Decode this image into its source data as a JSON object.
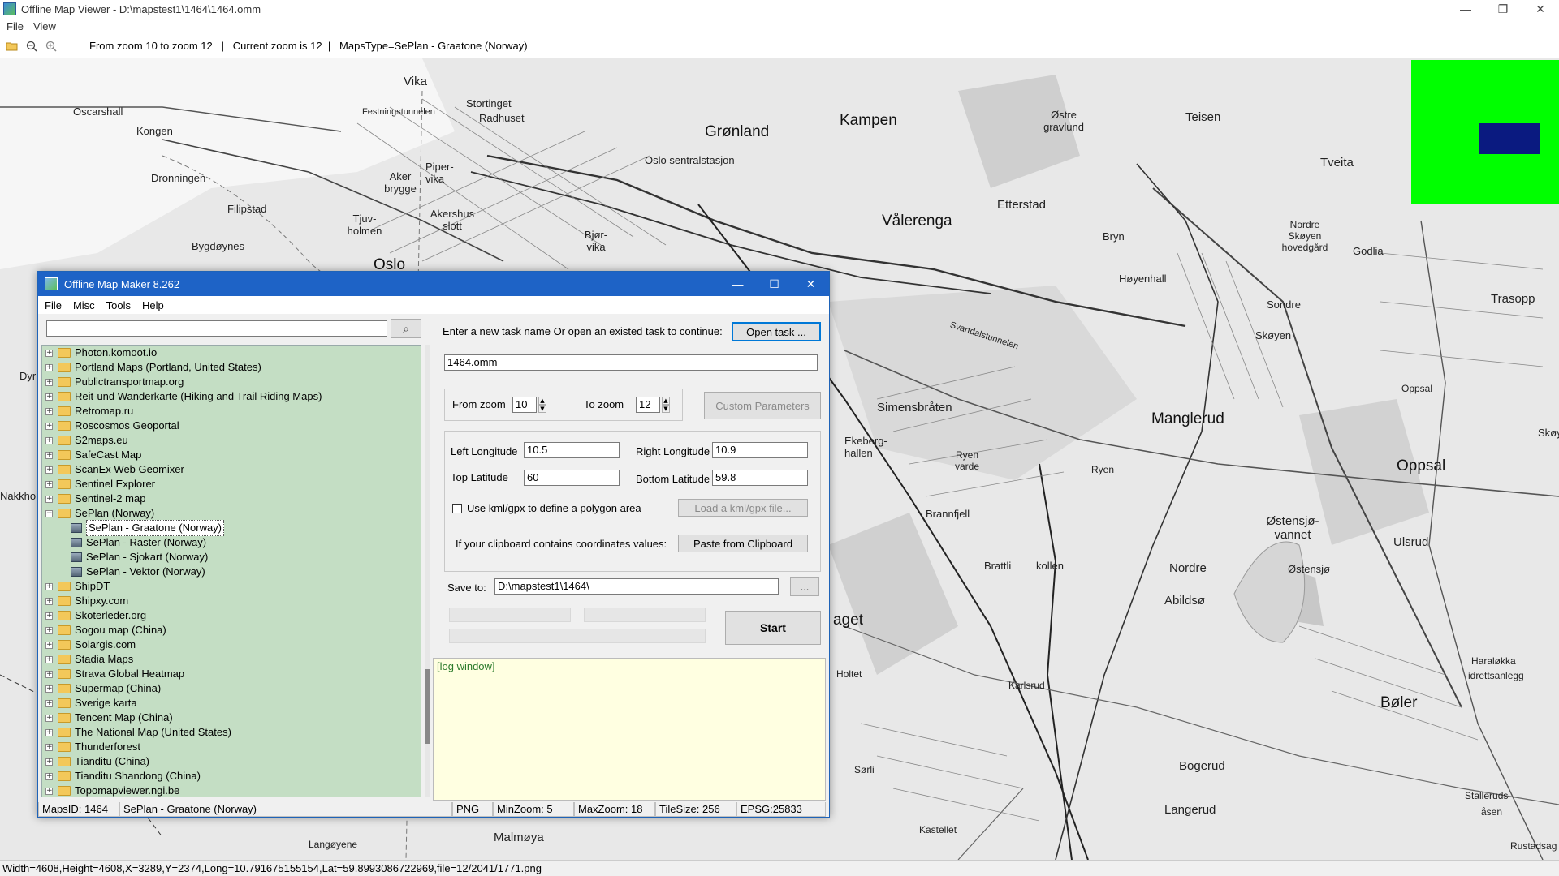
{
  "outer_window": {
    "title": "Offline Map Viewer - D:\\mapstest1\\1464\\1464.omm",
    "menu": [
      "File",
      "View"
    ],
    "toolbar_status": "From zoom 10 to zoom 12   |   Current zoom is 12  |   MapsType=SePlan - Graatone (Norway)",
    "controls": {
      "minimize": "—",
      "maximize": "❐",
      "close": "✕"
    }
  },
  "map": {
    "labels": [
      "Vika",
      "Stortinget",
      "Radhuset",
      "Festningstunnelen",
      "Oscarshall",
      "Kongen",
      "Dronningen",
      "Filipstad",
      "Bygdøynes",
      "Oslo",
      "Aker brygge",
      "Piper-vika",
      "Tjuv-holmen",
      "Akershus slott",
      "Bjør-vika",
      "Grønland",
      "Oslo sentralstasjon",
      "Kampen",
      "Østre gravlund",
      "Teisen",
      "Tveita",
      "Vålerenga",
      "Etterstad",
      "Bryn",
      "Nordre Skøyen hovedgård",
      "Godlia",
      "Trasopp",
      "Høyenhall",
      "Svartdalstunnelen",
      "Sondre",
      "Skøyen",
      "Oppsal",
      "Simensbråten",
      "Manglerud",
      "Ekeberg-hallen",
      "Ryen varde",
      "Ryen",
      "Oppsal",
      "Østensjø-vannet",
      "Ulsrud",
      "Østensjø",
      "Brannfjell",
      "Brattli",
      "kollen",
      "Nordre",
      "Abildsø",
      "Haraløkka",
      "idrettsanlegg",
      "Bøler",
      "Karlsrud",
      "Holtet",
      "Sørli",
      "Bogerud",
      "Langerud",
      "Stalleruds",
      "åsen",
      "Rustadsag",
      "Kastellet",
      "Langøyene",
      "Malmøya",
      "Dyr",
      "Nakkhol",
      "aget",
      "Skøy"
    ],
    "minimap_colors": {
      "background": "#00ff00",
      "viewport": "#0a1a80"
    }
  },
  "bottom_status": "Width=4608,Height=4608,X=3289,Y=2374,Long=10.791675155154,Lat=59.8993086722969,file=12/2041/1771.png",
  "dialog": {
    "title": "Offline Map Maker 8.262",
    "controls": {
      "minimize": "—",
      "maximize": "☐",
      "close": "✕"
    },
    "menu": [
      "File",
      "Misc",
      "Tools",
      "Help"
    ],
    "search": {
      "value": "",
      "icon": "search-icon"
    },
    "tree": [
      {
        "label": "Photon.komoot.io",
        "type": "folder"
      },
      {
        "label": "Portland Maps (Portland, United States)",
        "type": "folder"
      },
      {
        "label": "Publictransportmap.org",
        "type": "folder"
      },
      {
        "label": "Reit-und Wanderkarte (Hiking and Trail Riding Maps)",
        "type": "folder"
      },
      {
        "label": "Retromap.ru",
        "type": "folder"
      },
      {
        "label": "Roscosmos Geoportal",
        "type": "folder"
      },
      {
        "label": "S2maps.eu",
        "type": "folder"
      },
      {
        "label": "SafeCast Map",
        "type": "folder"
      },
      {
        "label": "ScanEx Web Geomixer",
        "type": "folder"
      },
      {
        "label": "Sentinel Explorer",
        "type": "folder"
      },
      {
        "label": "Sentinel-2 map",
        "type": "folder"
      },
      {
        "label": "SePlan (Norway)",
        "type": "folder-open"
      },
      {
        "label": "SePlan - Graatone (Norway)",
        "type": "map",
        "selected": true
      },
      {
        "label": "SePlan - Raster (Norway)",
        "type": "map"
      },
      {
        "label": "SePlan - Sjokart (Norway)",
        "type": "map"
      },
      {
        "label": "SePlan - Vektor (Norway)",
        "type": "map"
      },
      {
        "label": "ShipDT",
        "type": "folder"
      },
      {
        "label": "Shipxy.com",
        "type": "folder"
      },
      {
        "label": "Skoterleder.org",
        "type": "folder"
      },
      {
        "label": "Sogou map (China)",
        "type": "folder"
      },
      {
        "label": "Solargis.com",
        "type": "folder"
      },
      {
        "label": "Stadia Maps",
        "type": "folder"
      },
      {
        "label": "Strava Global Heatmap",
        "type": "folder"
      },
      {
        "label": "Supermap (China)",
        "type": "folder"
      },
      {
        "label": "Sverige karta",
        "type": "folder"
      },
      {
        "label": "Tencent Map (China)",
        "type": "folder"
      },
      {
        "label": "The National Map (United States)",
        "type": "folder"
      },
      {
        "label": "Thunderforest",
        "type": "folder"
      },
      {
        "label": "Tianditu (China)",
        "type": "folder"
      },
      {
        "label": "Tianditu Shandong (China)",
        "type": "folder"
      },
      {
        "label": "Topomapviewer.ngi.be",
        "type": "folder"
      }
    ],
    "task": {
      "prompt": "Enter a new task name Or open an existed task to continue:",
      "open_button": "Open task ...",
      "name_value": "1464.omm"
    },
    "zoom": {
      "from_label": "From zoom",
      "from_value": "10",
      "to_label": "To zoom",
      "to_value": "12",
      "custom_button": "Custom Parameters"
    },
    "coords": {
      "left_lon_label": "Left Longitude",
      "left_lon_value": "10.5",
      "right_lon_label": "Right Longitude",
      "right_lon_value": "10.9",
      "top_lat_label": "Top Latitude",
      "top_lat_value": "60",
      "bottom_lat_label": "Bottom Latitude",
      "bottom_lat_value": "59.8"
    },
    "kml": {
      "checkbox_label": "Use kml/gpx to define a polygon area",
      "load_button": "Load a kml/gpx file..."
    },
    "clipboard": {
      "label": "If your clipboard contains coordinates values:",
      "button": "Paste from Clipboard"
    },
    "save": {
      "label": "Save to:",
      "value": "D:\\mapstest1\\1464\\",
      "browse_button": "..."
    },
    "start_button": "Start",
    "log_text": "[log window]",
    "status": [
      "MapsID: 1464",
      "SePlan - Graatone (Norway)",
      "PNG",
      "MinZoom: 5",
      "MaxZoom: 18",
      "TileSize: 256",
      "EPSG:25833"
    ]
  }
}
